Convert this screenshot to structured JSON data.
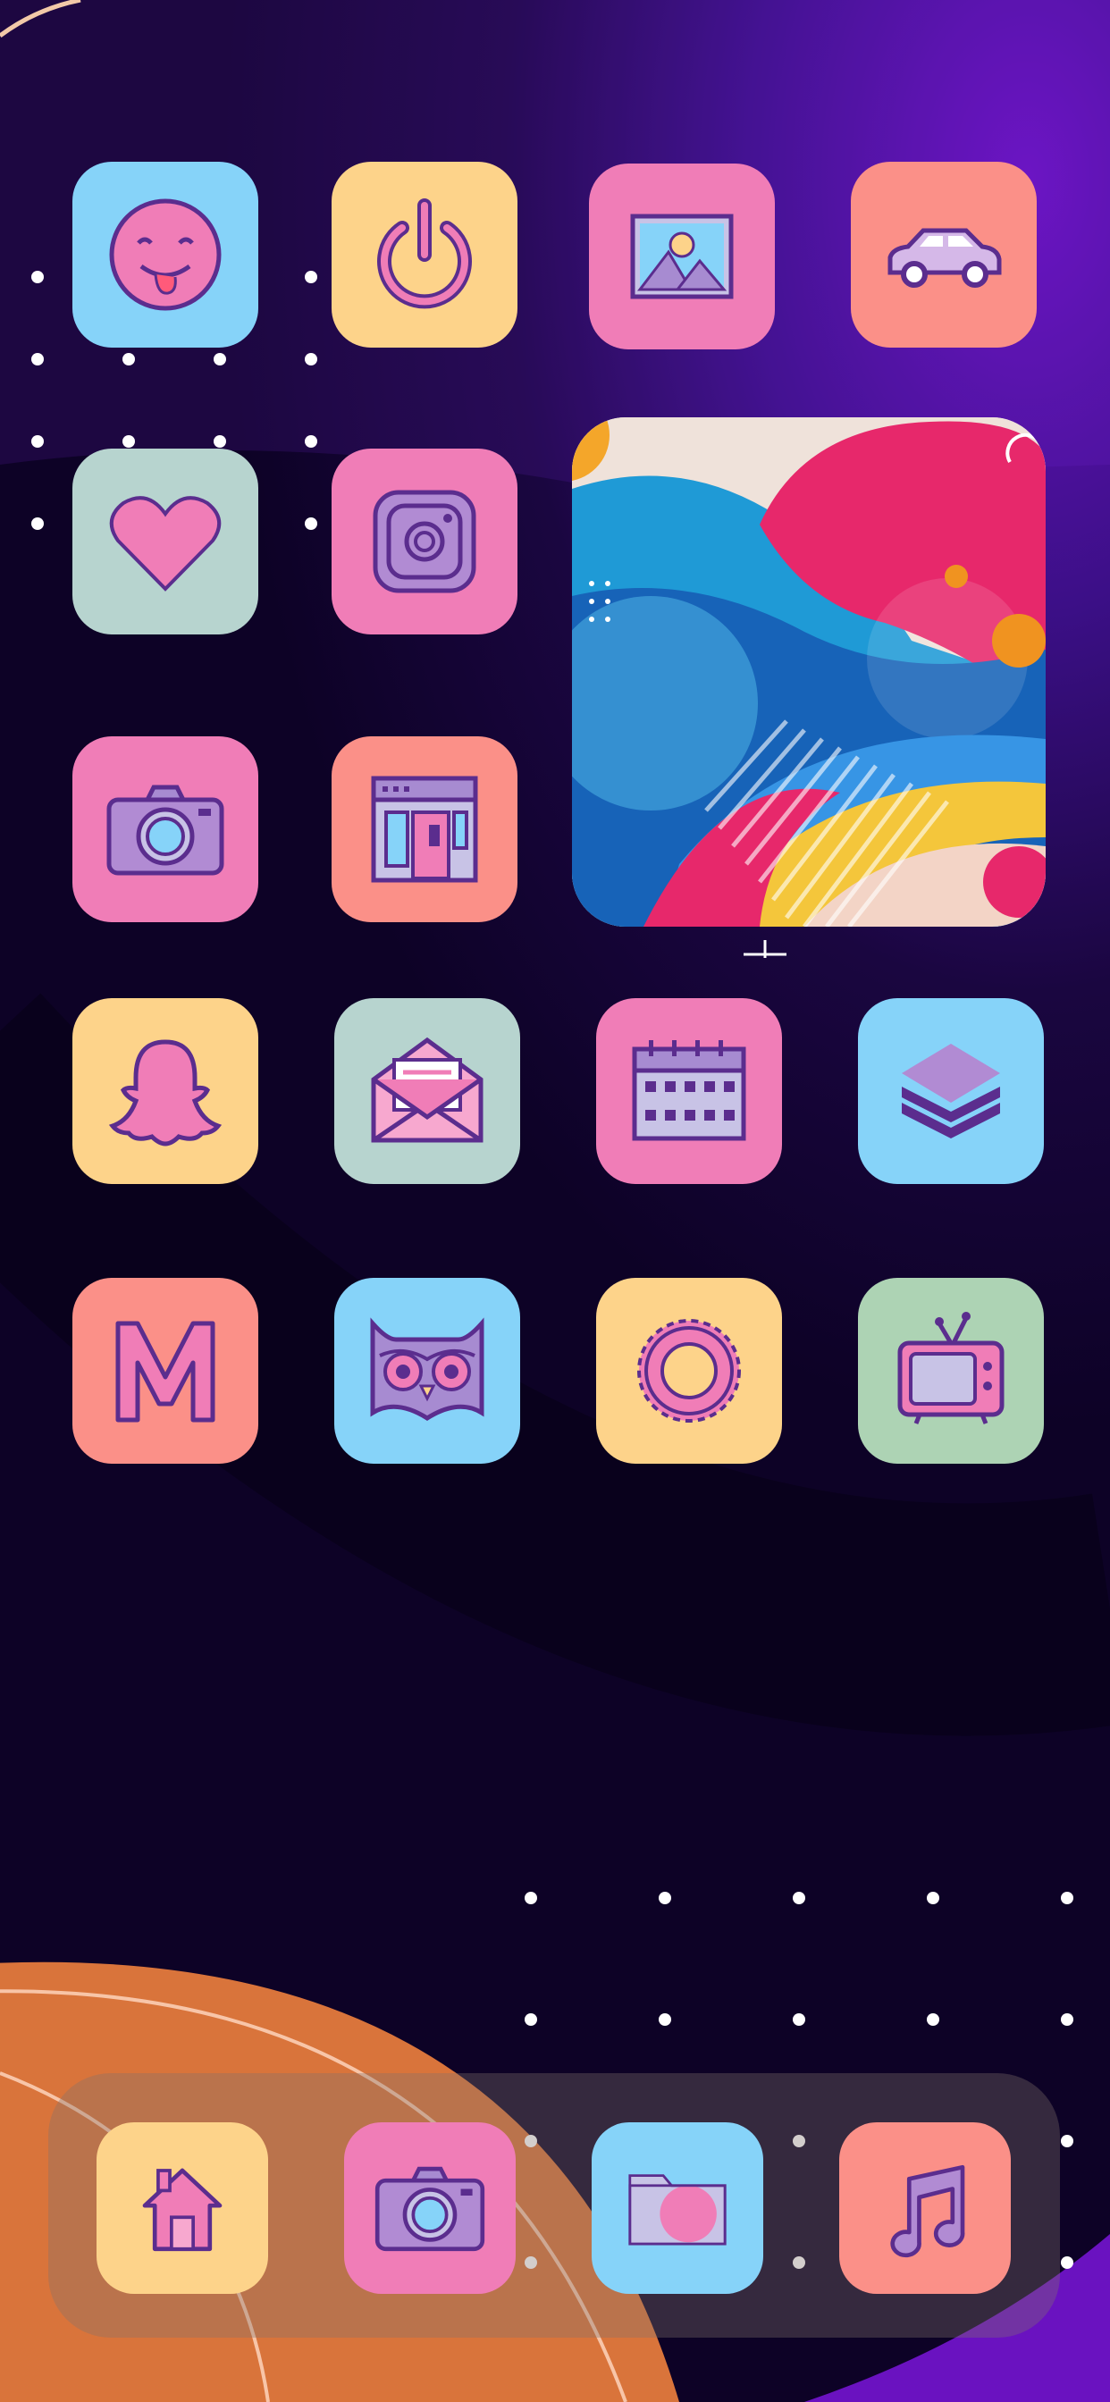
{
  "home_screen": {
    "rows": [
      [
        {
          "name": "emoji-app-icon",
          "icon": "tongue-emoji-icon",
          "bg": "#86d3f9"
        },
        {
          "name": "power-app-icon",
          "icon": "power-icon",
          "bg": "#fdd38a"
        },
        {
          "name": "photos-app-icon",
          "icon": "picture-icon",
          "bg": "#f07db7"
        },
        {
          "name": "car-app-icon",
          "icon": "car-icon",
          "bg": "#fb9088"
        }
      ],
      [
        {
          "name": "health-app-icon",
          "icon": "heart-icon",
          "bg": "#b7d4cf"
        },
        {
          "name": "instagram-app-icon",
          "icon": "instagram-icon",
          "bg": "#f07db7"
        }
      ],
      [
        {
          "name": "camera-app-icon",
          "icon": "camera-icon",
          "bg": "#f07db7"
        },
        {
          "name": "browser-app-icon",
          "icon": "browser-icon",
          "bg": "#fb9088"
        }
      ],
      [
        {
          "name": "snapchat-app-icon",
          "icon": "ghost-icon",
          "bg": "#fdd38a"
        },
        {
          "name": "mail-app-icon",
          "icon": "envelope-icon",
          "bg": "#b7d4cf"
        },
        {
          "name": "calendar-app-icon",
          "icon": "calendar-icon",
          "bg": "#f07db7"
        },
        {
          "name": "layers-app-icon",
          "icon": "layers-icon",
          "bg": "#86d3f9"
        }
      ],
      [
        {
          "name": "gmail-app-icon",
          "icon": "letter-m-icon",
          "bg": "#fb9088"
        },
        {
          "name": "owl-app-icon",
          "icon": "owl-icon",
          "bg": "#86d3f9"
        },
        {
          "name": "settings-app-icon",
          "icon": "gear-icon",
          "bg": "#fdd38a"
        },
        {
          "name": "tv-app-icon",
          "icon": "tv-icon",
          "bg": "#add3b4"
        }
      ]
    ],
    "widget": {
      "name": "abstract-art-photo-widget"
    }
  },
  "dock": [
    {
      "name": "home-app-icon",
      "icon": "house-icon",
      "bg": "#fdd38a"
    },
    {
      "name": "dock-camera-app-icon",
      "icon": "camera-icon",
      "bg": "#f07db7"
    },
    {
      "name": "files-app-icon",
      "icon": "folder-icon",
      "bg": "#86d3f9"
    },
    {
      "name": "music-app-icon",
      "icon": "music-note-icon",
      "bg": "#fb9088"
    }
  ],
  "colors": {
    "outline": "#5b2d8e",
    "pink": "#f07db7",
    "purple_fill": "#a78bd1",
    "light_blue": "#86d3f9",
    "accent_pink": "#ff6fa5"
  }
}
